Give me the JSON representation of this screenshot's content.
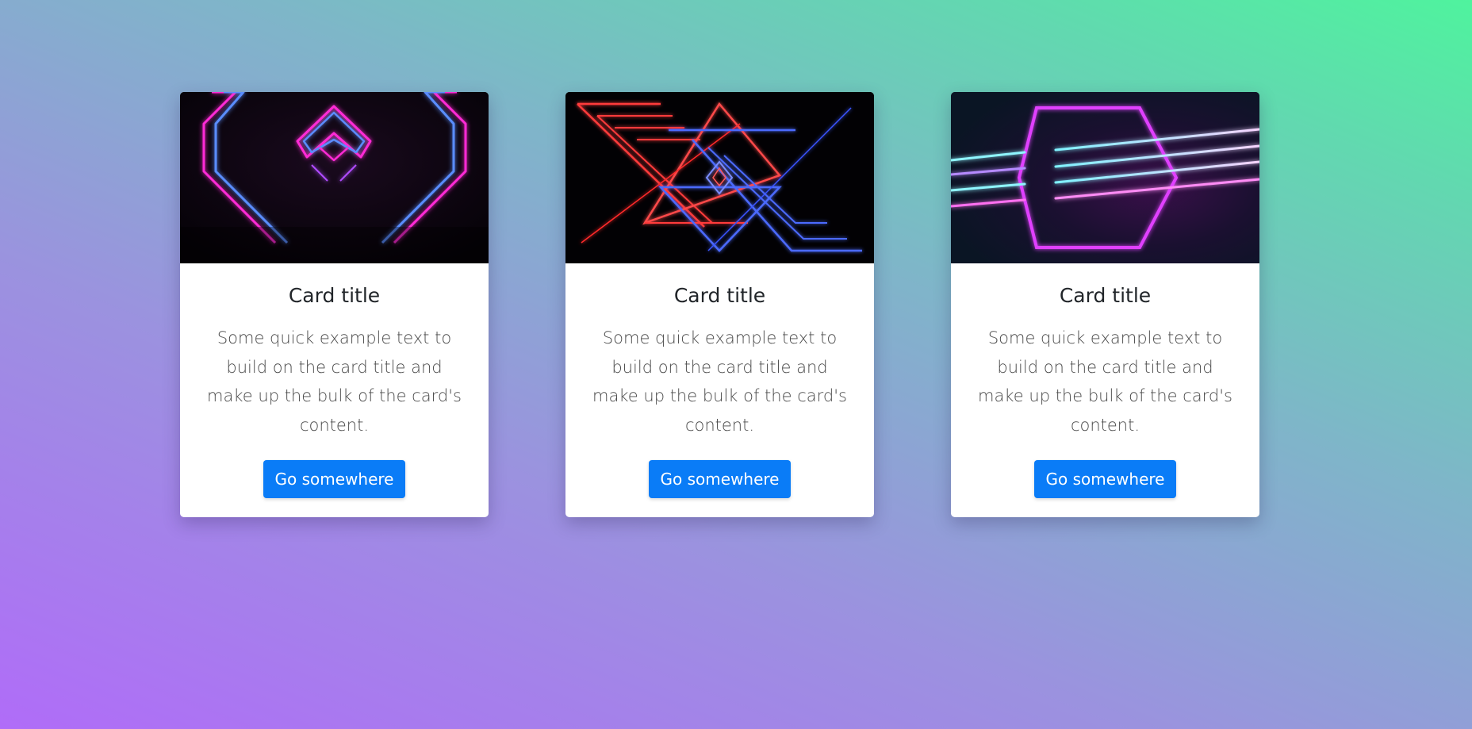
{
  "cards": [
    {
      "image_icon": "neon-diamond-tunnel-image",
      "title": "Card title",
      "text": "Some quick example text to build on the card title and make up the bulk of the card's content.",
      "button_label": "Go somewhere"
    },
    {
      "image_icon": "neon-triangles-image",
      "title": "Card title",
      "text": "Some quick example text to build on the card title and make up the bulk of the card's content.",
      "button_label": "Go somewhere"
    },
    {
      "image_icon": "neon-hexagon-image",
      "title": "Card title",
      "text": "Some quick example text to build on the card title and make up the bulk of the card's content.",
      "button_label": "Go somewhere"
    }
  ],
  "colors": {
    "button": "#0a7cf7",
    "gradient_start": "#b06cf8",
    "gradient_end": "#4ff39e"
  }
}
